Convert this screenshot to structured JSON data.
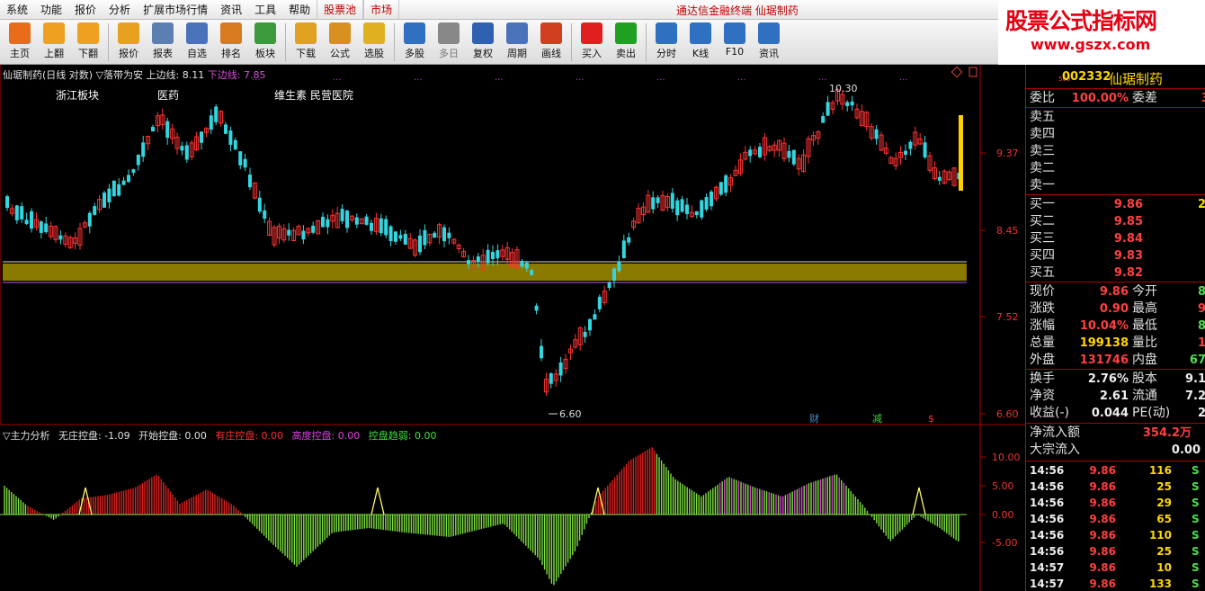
{
  "menubar": {
    "items": [
      "系统",
      "功能",
      "报价",
      "分析",
      "扩展市场行情",
      "资讯",
      "工具",
      "帮助"
    ],
    "tabs": [
      "股票池",
      "市场"
    ],
    "right_text": "通达信金融终端  仙琚制药"
  },
  "toolbar": {
    "buttons": [
      {
        "label": "主页",
        "icon": "home-icon",
        "color": "#e86c1a"
      },
      {
        "label": "上翻",
        "icon": "up-arrow-icon",
        "color": "#f0a020"
      },
      {
        "label": "下翻",
        "icon": "down-arrow-icon",
        "color": "#f0a020"
      },
      {
        "label": "报价",
        "icon": "yen-icon",
        "color": "#e8a020"
      },
      {
        "label": "报表",
        "icon": "report-icon",
        "color": "#5a7fb0"
      },
      {
        "label": "自选",
        "icon": "f6-icon",
        "color": "#4a72b8"
      },
      {
        "label": "排名",
        "icon": "rank-icon",
        "color": "#d87a20"
      },
      {
        "label": "板块",
        "icon": "block-icon",
        "color": "#3c9a3c"
      },
      {
        "label": "下载",
        "icon": "download-icon",
        "color": "#e0a020"
      },
      {
        "label": "公式",
        "icon": "formula-icon",
        "color": "#d89020"
      },
      {
        "label": "选股",
        "icon": "select-icon",
        "color": "#e0b020"
      },
      {
        "label": "多股",
        "icon": "multi-icon",
        "color": "#3070c0"
      },
      {
        "label": "多日",
        "icon": "clock-icon",
        "color": "#888888",
        "dim": true
      },
      {
        "label": "复权",
        "icon": "rights-icon",
        "color": "#3060b0"
      },
      {
        "label": "周期",
        "icon": "f8-icon",
        "color": "#4a72b8"
      },
      {
        "label": "画线",
        "icon": "pen-icon",
        "color": "#d04020"
      },
      {
        "label": "买入",
        "icon": "buy-icon",
        "color": "#e02020"
      },
      {
        "label": "卖出",
        "icon": "sell-icon",
        "color": "#20a020"
      },
      {
        "label": "分时",
        "icon": "intraday-icon",
        "color": "#3070c0"
      },
      {
        "label": "K线",
        "icon": "kline-icon",
        "color": "#3070c0"
      },
      {
        "label": "F10",
        "icon": "f10-icon",
        "color": "#3070c0"
      },
      {
        "label": "资讯",
        "icon": "news-icon",
        "color": "#3070c0"
      }
    ]
  },
  "logo": {
    "main": "股票公式指标网",
    "sub": "www.gszx.com"
  },
  "price_chart": {
    "header_title": "仙琚制药(日线 对数) ▽落带为安",
    "upper_label": "上边线: 8.11",
    "lower_label": "下边线: 7.85",
    "sectors": [
      "浙江板块",
      "医药",
      "维生素 民营医院"
    ],
    "y_axis": [
      "9.37",
      "8.45",
      "7.52",
      "6.60"
    ],
    "high_marker": "10.30",
    "low_marker": "6.60",
    "event_marks": [
      "财",
      "减",
      "$"
    ]
  },
  "indicator": {
    "title": "▽主力分析",
    "items": [
      {
        "label": "无庄控盘: -1.09",
        "color": "#e0e0e0"
      },
      {
        "label": "开始控盘: 0.00",
        "color": "#e0e0e0"
      },
      {
        "label": "有庄控盘: 0.00",
        "color": "#ff3030"
      },
      {
        "label": "高度控盘: 0.00",
        "color": "#e040e0"
      },
      {
        "label": "控盘趋弱: 0.00",
        "color": "#40e040"
      }
    ],
    "y_axis": [
      "10.00",
      "5.00",
      "0.00",
      "-5.00"
    ]
  },
  "quote_panel": {
    "code": "002332",
    "name": "仙琚制药",
    "code_prefix": "500",
    "weibi_label": "委比",
    "weibi_value": "100.00%",
    "weicha_label": "委差",
    "weicha_value": "3",
    "sell_labels": [
      "卖五",
      "卖四",
      "卖三",
      "卖二",
      "卖一"
    ],
    "buy_levels": [
      {
        "label": "买一",
        "price": "9.86",
        "vol": "2"
      },
      {
        "label": "买二",
        "price": "9.85",
        "vol": ""
      },
      {
        "label": "买三",
        "price": "9.84",
        "vol": ""
      },
      {
        "label": "买四",
        "price": "9.83",
        "vol": ""
      },
      {
        "label": "买五",
        "price": "9.82",
        "vol": ""
      }
    ],
    "stats": [
      {
        "l1": "现价",
        "v1": "9.86",
        "c1": "red",
        "l2": "今开",
        "v2": "8",
        "c2": "green"
      },
      {
        "l1": "涨跌",
        "v1": "0.90",
        "c1": "red",
        "l2": "最高",
        "v2": "9",
        "c2": "red"
      },
      {
        "l1": "涨幅",
        "v1": "10.04%",
        "c1": "red",
        "l2": "最低",
        "v2": "8",
        "c2": "green"
      },
      {
        "l1": "总量",
        "v1": "199138",
        "c1": "yellow",
        "l2": "量比",
        "v2": "1",
        "c2": "red"
      },
      {
        "l1": "外盘",
        "v1": "131746",
        "c1": "red",
        "l2": "内盘",
        "v2": "67",
        "c2": "green"
      }
    ],
    "stats2": [
      {
        "l1": "换手",
        "v1": "2.76%",
        "l2": "股本",
        "v2": "9.1"
      },
      {
        "l1": "净资",
        "v1": "2.61",
        "l2": "流通",
        "v2": "7.2"
      },
      {
        "l1": "收益(-)",
        "v1": "0.044",
        "l2": "PE(动)",
        "v2": "2"
      }
    ],
    "netflow_label": "净流入额",
    "netflow_value": "354.2万",
    "block_label": "大宗流入",
    "block_value": "0.00",
    "ticks": [
      {
        "time": "14:56",
        "price": "9.86",
        "vol": "116",
        "side": "S"
      },
      {
        "time": "14:56",
        "price": "9.86",
        "vol": "25",
        "side": "S"
      },
      {
        "time": "14:56",
        "price": "9.86",
        "vol": "29",
        "side": "S"
      },
      {
        "time": "14:56",
        "price": "9.86",
        "vol": "65",
        "side": "S"
      },
      {
        "time": "14:56",
        "price": "9.86",
        "vol": "110",
        "side": "S"
      },
      {
        "time": "14:56",
        "price": "9.86",
        "vol": "25",
        "side": "S"
      },
      {
        "time": "14:57",
        "price": "9.86",
        "vol": "10",
        "side": "S"
      },
      {
        "time": "14:57",
        "price": "9.86",
        "vol": "133",
        "side": "S"
      }
    ]
  },
  "colors": {
    "up": "#ff3333",
    "down": "#33d6e0",
    "band": "#8a7a00",
    "grid": "#7a0000"
  }
}
